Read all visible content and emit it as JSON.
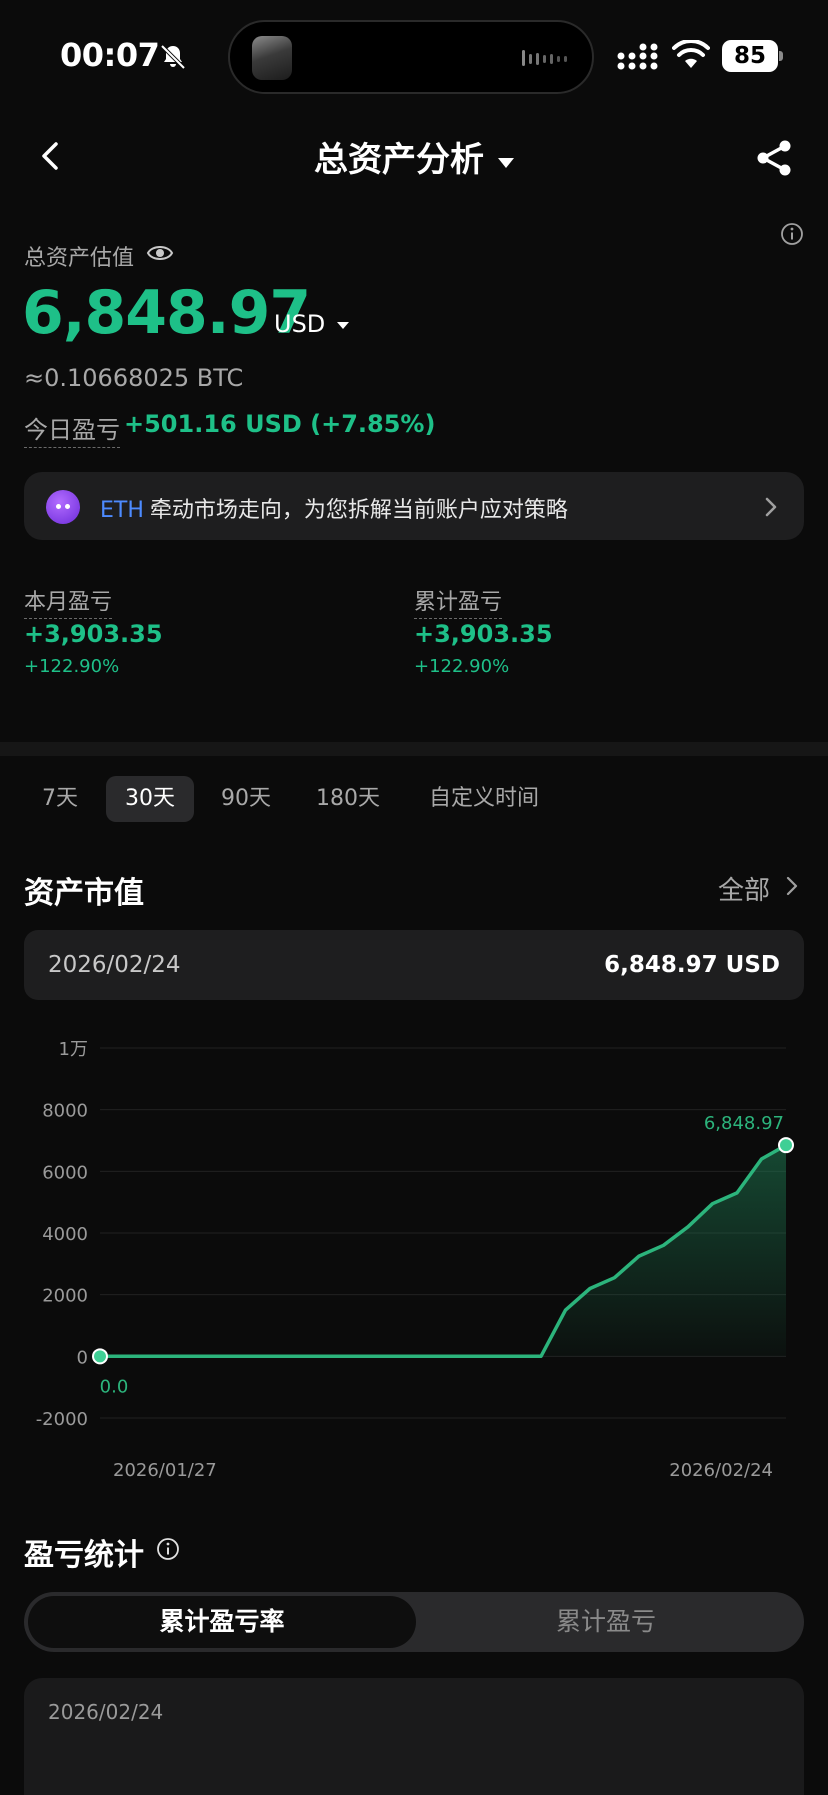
{
  "status_bar": {
    "time": "00:07",
    "battery": "85"
  },
  "header": {
    "title": "总资产分析"
  },
  "balance": {
    "label": "总资产估值",
    "value": "6,848.97",
    "currency": "USD",
    "btc": "≈0.10668025 BTC",
    "today_label": "今日盈亏",
    "today_value": "+501.16 USD (+7.85%)"
  },
  "banner": {
    "coin": "ETH",
    "text": "牵动市场走向，为您拆解当前账户应对策略"
  },
  "stats": {
    "month": {
      "label": "本月盈亏",
      "value": "+3,903.35",
      "pct": "+122.90%"
    },
    "total": {
      "label": "累计盈亏",
      "value": "+3,903.35",
      "pct": "+122.90%"
    }
  },
  "range_tabs": [
    "7天",
    "30天",
    "90天",
    "180天",
    "自定义时间"
  ],
  "active_range": "30天",
  "asset_section": {
    "title": "资产市值",
    "all_label": "全部",
    "selected_date": "2026/02/24",
    "selected_value": "6,848.97 USD"
  },
  "chart_data": {
    "type": "area",
    "x": [
      "2026/01/27",
      "2026/01/28",
      "2026/01/29",
      "2026/01/30",
      "2026/01/31",
      "2026/02/01",
      "2026/02/02",
      "2026/02/03",
      "2026/02/04",
      "2026/02/05",
      "2026/02/06",
      "2026/02/07",
      "2026/02/08",
      "2026/02/09",
      "2026/02/10",
      "2026/02/11",
      "2026/02/12",
      "2026/02/13",
      "2026/02/14",
      "2026/02/15",
      "2026/02/16",
      "2026/02/17",
      "2026/02/18",
      "2026/02/19",
      "2026/02/20",
      "2026/02/21",
      "2026/02/22",
      "2026/02/23",
      "2026/02/24"
    ],
    "values": [
      0,
      0,
      0,
      0,
      0,
      0,
      0,
      0,
      0,
      0,
      0,
      0,
      0,
      0,
      0,
      0,
      0,
      0,
      0,
      1500,
      2200,
      2550,
      3250,
      3600,
      4200,
      4950,
      5300,
      6400,
      6848.97
    ],
    "yticks": [
      {
        "v": 10000,
        "label": "1万"
      },
      {
        "v": 8000,
        "label": "8000"
      },
      {
        "v": 6000,
        "label": "6000"
      },
      {
        "v": 4000,
        "label": "4000"
      },
      {
        "v": 2000,
        "label": "2000"
      },
      {
        "v": 0,
        "label": "0"
      },
      {
        "v": -2000,
        "label": "-2000"
      }
    ],
    "ylim": [
      -2000,
      10000
    ],
    "x_tick_labels": [
      "2026/01/27",
      "2026/02/24"
    ],
    "start_label": "0.0",
    "end_label": "6,848.97",
    "line_color": "#2cb47c",
    "grid": true
  },
  "pnl_section": {
    "title": "盈亏统计",
    "seg_active": "累计盈亏率",
    "seg_inactive": "累计盈亏",
    "date": "2026/02/24"
  },
  "colors": {
    "accent_green": "#1ec088",
    "background": "#0b0b0b",
    "card": "#1e1e1f"
  }
}
